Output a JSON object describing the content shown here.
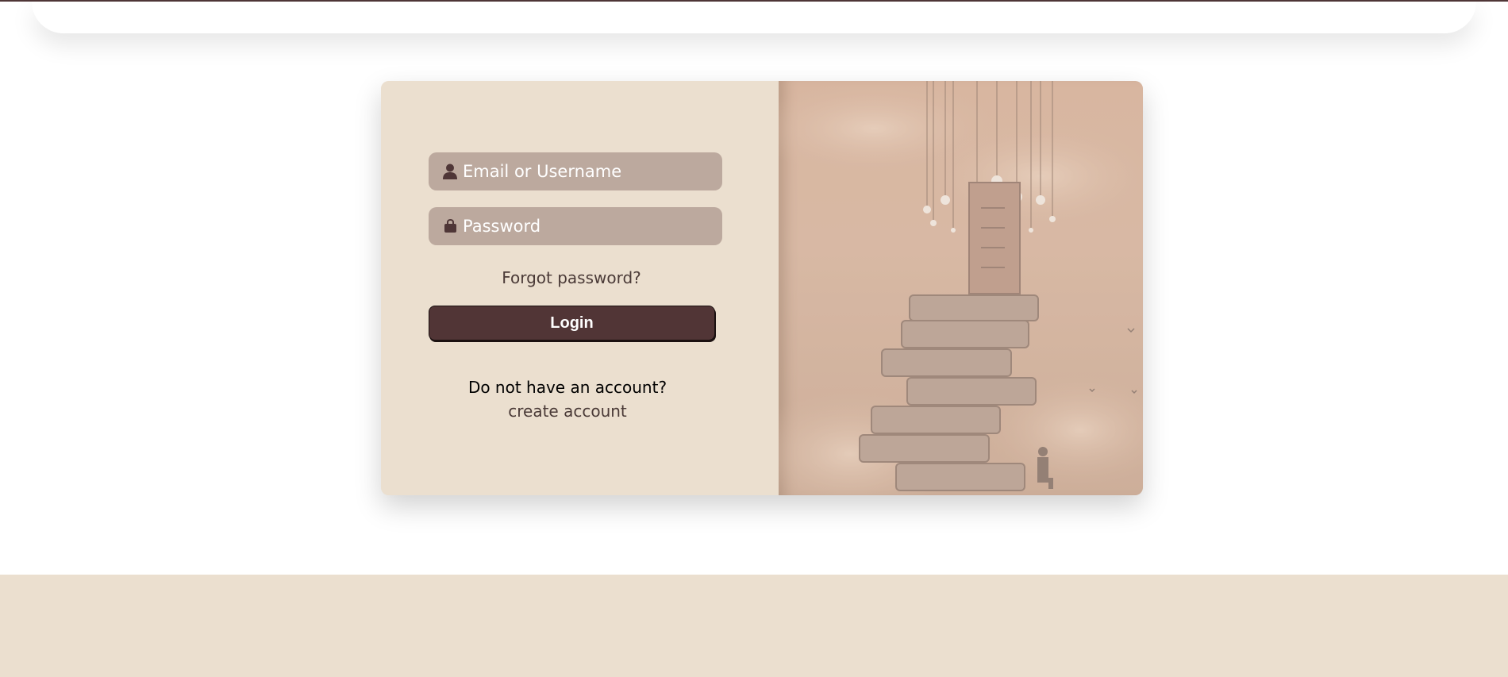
{
  "login": {
    "email_placeholder": "Email or Username",
    "password_placeholder": "Password",
    "forgot_label": "Forgot password?",
    "login_label": "Login",
    "no_account_text": "Do not have an account?",
    "create_account_label": "create account"
  },
  "icons": {
    "email": "user-icon",
    "password": "lock-icon"
  },
  "colors": {
    "accent": "#513536",
    "panel": "#ebdfcf",
    "field": "#bca99e"
  }
}
